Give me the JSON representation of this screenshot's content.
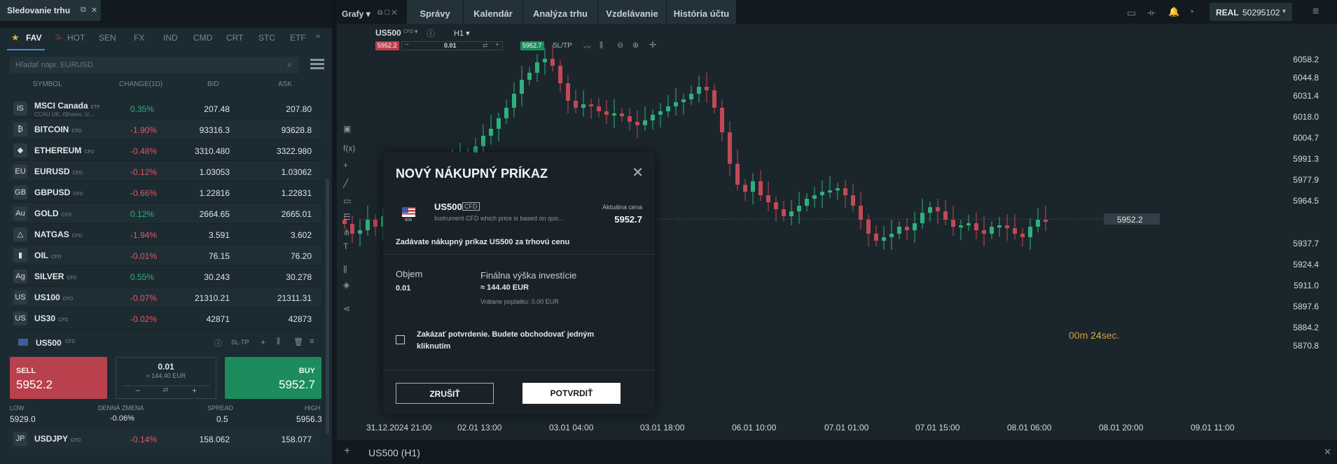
{
  "watchlist": {
    "title": "Sledovanie trhu",
    "categories": [
      "FAV",
      "HOT",
      "SEN",
      "FX",
      "IND",
      "CMD",
      "CRT",
      "STC",
      "ETF"
    ],
    "search_placeholder": "Hľadať napr. EURUSD",
    "headers": {
      "symbol": "SYMBOL",
      "change": "CHANGE(1D)",
      "bid": "BID",
      "ask": "ASK"
    },
    "rows": [
      {
        "logo": "iS",
        "name": "MSCI Canada",
        "type": "ETF",
        "sub": "CCAU.UK, iShares, U...",
        "change": "0.35%",
        "dir": "pos",
        "bid": "207.48",
        "ask": "207.80"
      },
      {
        "logo": "₿",
        "name": "BITCOIN",
        "type": "CFD",
        "sub": "",
        "change": "-1.90%",
        "dir": "neg",
        "bid": "93316.3",
        "ask": "93628.8"
      },
      {
        "logo": "◆",
        "name": "ETHEREUM",
        "type": "CFD",
        "sub": "",
        "change": "-0.48%",
        "dir": "neg",
        "bid": "3310.480",
        "ask": "3322.980"
      },
      {
        "logo": "EU",
        "name": "EURUSD",
        "type": "CFD",
        "sub": "",
        "change": "-0.12%",
        "dir": "neg",
        "bid": "1.03053",
        "ask": "1.03062"
      },
      {
        "logo": "GB",
        "name": "GBPUSD",
        "type": "CFD",
        "sub": "",
        "change": "-0.66%",
        "dir": "neg",
        "bid": "1.22816",
        "ask": "1.22831"
      },
      {
        "logo": "Au",
        "name": "GOLD",
        "type": "CFD",
        "sub": "",
        "change": "0.12%",
        "dir": "pos",
        "bid": "2664.65",
        "ask": "2665.01"
      },
      {
        "logo": "△",
        "name": "NATGAS",
        "type": "CFD",
        "sub": "",
        "change": "-1.94%",
        "dir": "neg",
        "bid": "3.591",
        "ask": "3.602"
      },
      {
        "logo": "▮",
        "name": "OIL",
        "type": "CFD",
        "sub": "",
        "change": "-0.01%",
        "dir": "neg",
        "bid": "76.15",
        "ask": "76.20"
      },
      {
        "logo": "Ag",
        "name": "SILVER",
        "type": "CFD",
        "sub": "",
        "change": "0.55%",
        "dir": "pos",
        "bid": "30.243",
        "ask": "30.278"
      },
      {
        "logo": "US",
        "name": "US100",
        "type": "CFD",
        "sub": "",
        "change": "-0.07%",
        "dir": "neg",
        "bid": "21310.21",
        "ask": "21311.31"
      },
      {
        "logo": "US",
        "name": "US30",
        "type": "CFD",
        "sub": "",
        "change": "-0.02%",
        "dir": "neg",
        "bid": "42871",
        "ask": "42873"
      }
    ],
    "selected": {
      "name": "US500",
      "type": "CFD",
      "sltp": "SL-TP"
    },
    "trade": {
      "sell": "SELL",
      "sell_price": "5952.2",
      "buy": "BUY",
      "buy_price": "5952.7",
      "qty": "0.01",
      "qty_eur": "≈ 144.40 EUR"
    },
    "stats": {
      "low_label": "LOW",
      "low": "5929.0",
      "daily_label": "DENNÁ ZMENA",
      "daily": "-0.06%",
      "spread_label": "SPREAD",
      "spread": "0.5",
      "high_label": "HIGH",
      "high": "5956.3"
    },
    "last_row": {
      "logo": "JP",
      "name": "USDJPY",
      "type": "CFD",
      "change": "-0.14%",
      "bid": "158.062",
      "ask": "158.077"
    }
  },
  "topbar": {
    "grafy": "Grafy",
    "menu": [
      "Správy",
      "Kalendár",
      "Analýza trhu",
      "Vzdelávanie",
      "História účtu"
    ],
    "account_type": "REAL",
    "account_id": "50295102"
  },
  "chart": {
    "symbol": "US500",
    "symbol_type": "CFD",
    "timeframe": "H1",
    "sell_price": "5952.2",
    "qty": "0.01",
    "buy_price": "5952.7",
    "sltp": "SL/TP",
    "current_price": "5952.2",
    "timer_min": "00",
    "timer_min_unit": "m",
    "timer_sec": "24",
    "timer_sec_unit": "sec.",
    "bottom_title": "US500 (H1)",
    "price_labels": [
      "6058.2",
      "6044.8",
      "6031.4",
      "6018.0",
      "6004.7",
      "5991.3",
      "5977.9",
      "5964.5",
      "5937.7",
      "5924.4",
      "5911.0",
      "5897.6",
      "5884.2",
      "5870.8"
    ],
    "time_labels": [
      "31.12.2024 21:00",
      "02.01 13:00",
      "03.01 04:00",
      "03.01 18:00",
      "06.01 10:00",
      "07.01 01:00",
      "07.01 15:00",
      "08.01 06:00",
      "08.01 20:00",
      "09.01 11:00"
    ]
  },
  "modal": {
    "title": "NOVÝ NÁKUPNÝ PRÍKAZ",
    "symbol": "US500",
    "symbol_type": "CFD",
    "description": "Instrument CFD which price is based on quo...",
    "current_label": "Aktuálna cena",
    "current_price": "5952.7",
    "info": "Zadávate nákupný príkaz US500 za trhovú cenu",
    "volume_label": "Objem",
    "volume": "0.01",
    "final_label": "Finálna výška investície",
    "final_value": "≈ 144.40 EUR",
    "refund": "Vrátane poplatku: 0.00 EUR",
    "disable_confirm": "Zakázať potvrdenie. Budete obchodovať jedným kliknutím",
    "cancel": "ZRUŠIŤ",
    "confirm": "POTVRDIŤ",
    "flag_label": "500"
  },
  "colors": {
    "up": "#2fb07d",
    "down": "#c24855",
    "accent": "#3a8bd6",
    "bg": "#1b262c"
  }
}
